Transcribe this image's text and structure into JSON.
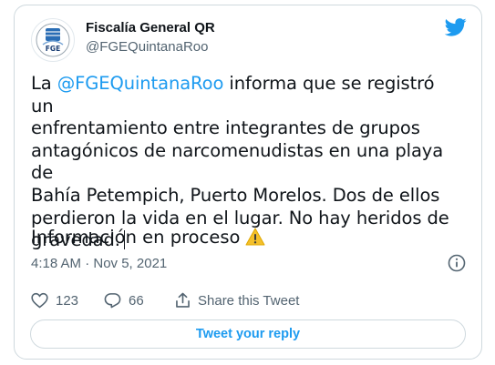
{
  "author": {
    "name": "Fiscalía General QR",
    "handle": "@FGEQuintanaRoo",
    "avatar_text": "FGE"
  },
  "tweet": {
    "prefix": "La ",
    "mention": "@FGEQuintanaRoo",
    "body_lines": [
      " informa que se registró un",
      "enfrentamiento entre integrantes de grupos",
      "antagónicos de narcomenudistas en una playa de",
      "Bahía Petempich, Puerto Morelos. Dos de ellos",
      "perdieron la vida en el lugar. No hay heridos de",
      "gravedad."
    ],
    "info_line": "Información en proceso",
    "info_emoji": "warning-icon"
  },
  "meta": {
    "timestamp": "4:18 AM · Nov 5, 2021"
  },
  "actions": {
    "likes": "123",
    "replies": "66",
    "share_label": "Share this Tweet"
  },
  "reply_button": "Tweet your reply",
  "colors": {
    "accent": "#1d9bf0",
    "text": "#0f1419",
    "muted": "#536471",
    "border": "#cfd9de",
    "warning": "#f4c02b"
  }
}
